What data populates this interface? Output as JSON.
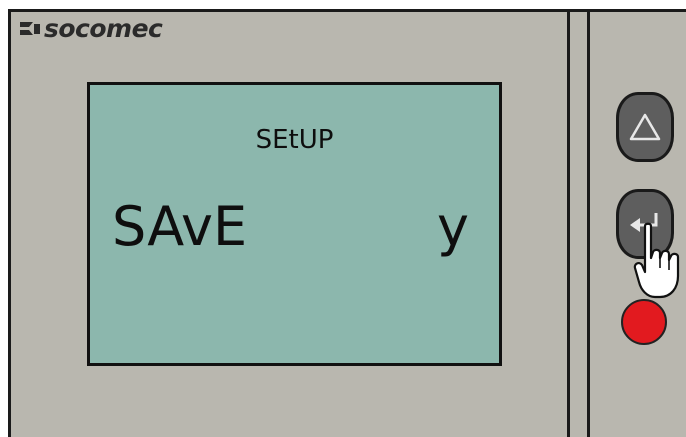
{
  "brand": {
    "name": "socomec",
    "mark_icon": "socomec-logo-icon"
  },
  "display": {
    "menu_title": "SEtUP",
    "parameter_label": "SAvE",
    "parameter_value": "y"
  },
  "buttons": {
    "up": {
      "icon": "triangle-up-icon"
    },
    "enter": {
      "icon": "enter-return-icon"
    }
  },
  "indicator": {
    "color": "#e21a1f"
  },
  "pointer": {
    "icon": "hand-pointer-icon"
  },
  "colors": {
    "housing": "#b9b7af",
    "lcd_background": "#8cb7ad",
    "button_fill": "#5e5e5e"
  }
}
